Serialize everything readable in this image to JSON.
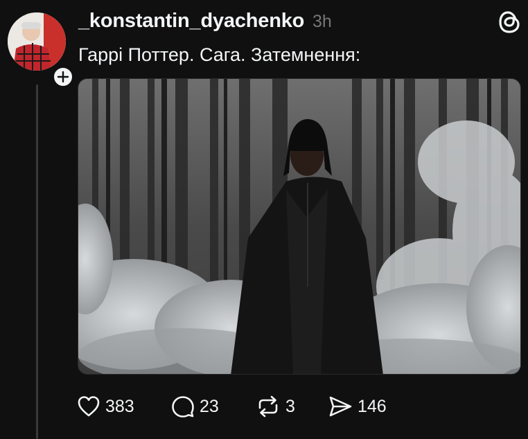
{
  "post": {
    "username": "_konstantin_dyachenko",
    "time": "3h",
    "text": "Гаррі Поттер. Сага. Затемнення:"
  },
  "actions": {
    "likes": "383",
    "replies": "23",
    "reposts": "3",
    "shares": "146"
  },
  "icons": {
    "app": "threads-icon",
    "follow": "plus-icon",
    "like": "heart-icon",
    "reply": "comment-icon",
    "repost": "repost-icon",
    "share": "send-icon"
  },
  "colors": {
    "background": "#101010",
    "text": "#f3f5f7",
    "secondary": "#777777",
    "thread_line": "#3a3a3a"
  }
}
